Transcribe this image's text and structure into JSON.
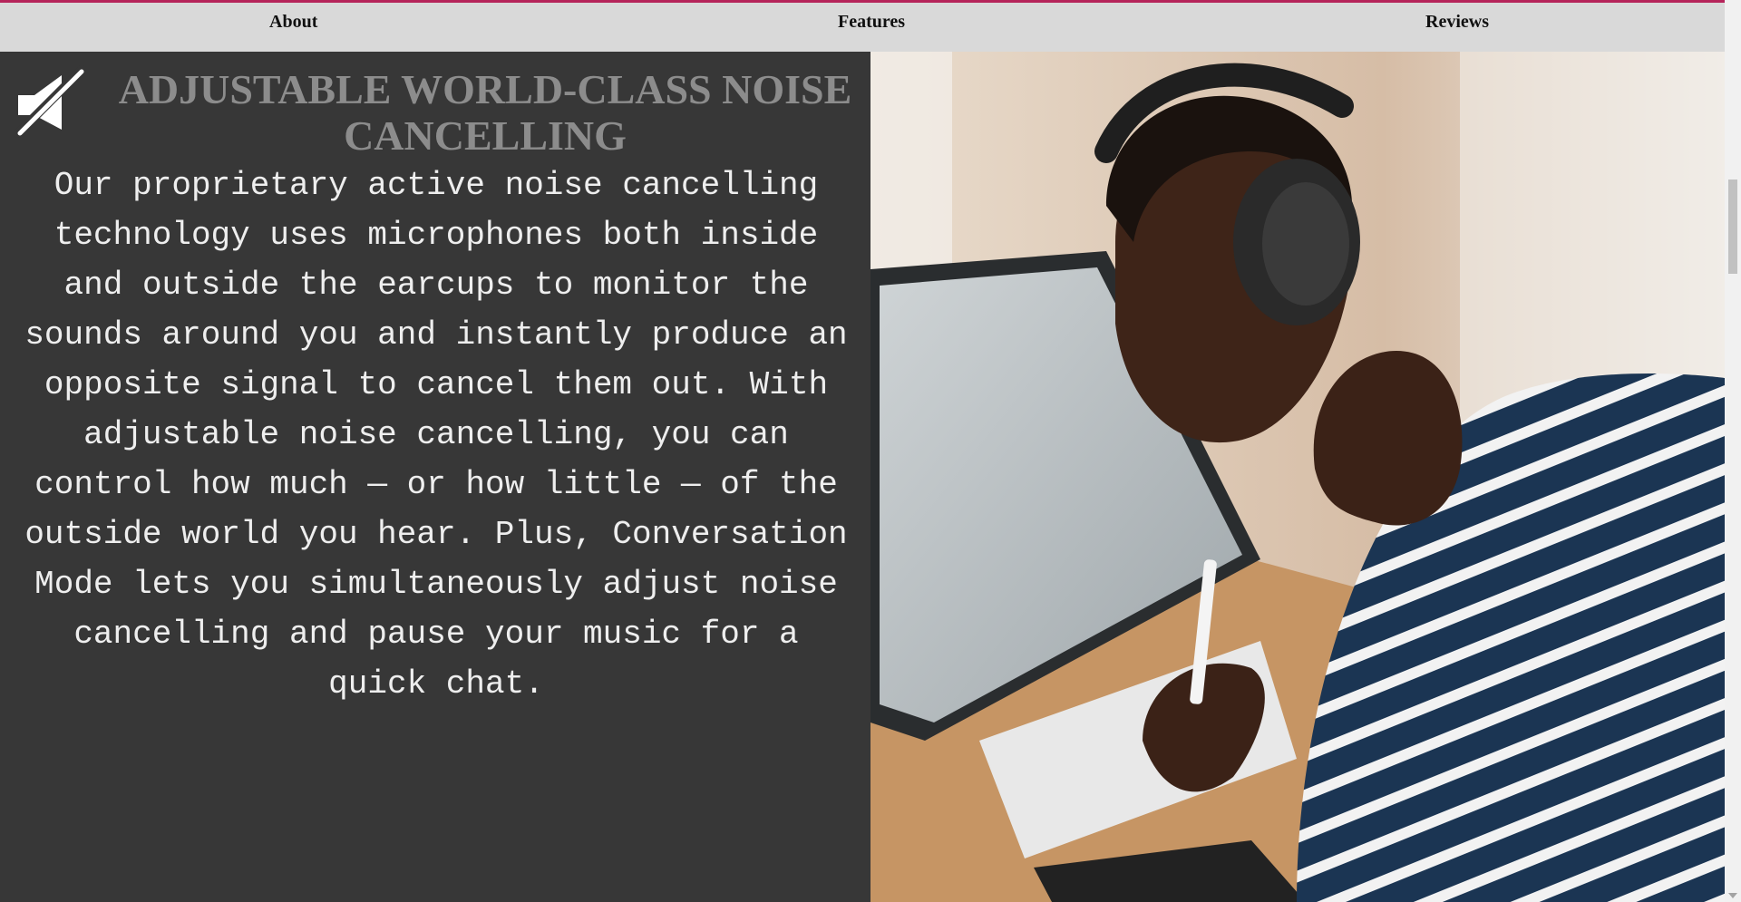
{
  "nav": {
    "about": "About",
    "features": "Features",
    "reviews": "Reviews"
  },
  "feature": {
    "icon": "muted-speaker-icon",
    "heading": "ADJUSTABLE WORLD-CLASS NOISE CANCELLING",
    "body": "Our proprietary active noise cancelling technology uses microphones both inside and outside the earcups to monitor the sounds around you and instantly produce an opposite signal to cancel them out. With adjustable noise cancelling, you can control how much — or how little — of the outside world you hear. Plus, Conversation Mode lets you simultaneously adjust noise cancelling and pause your music for a quick chat."
  },
  "colors": {
    "accent": "#b5245a",
    "navbar": "#d9d9d9",
    "panel": "#373737",
    "heading": "#8c8c8c",
    "body_text": "#eeeeee"
  }
}
